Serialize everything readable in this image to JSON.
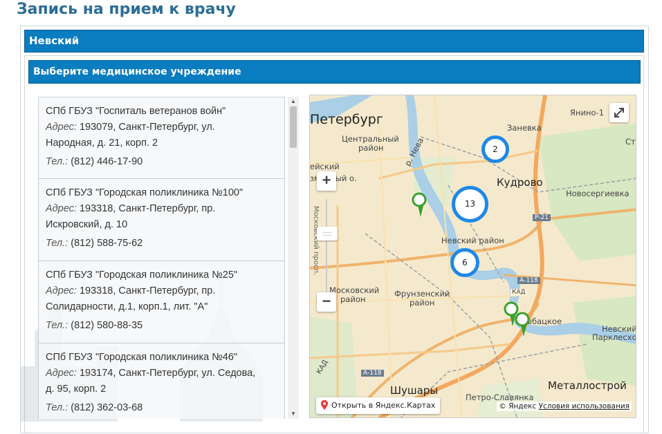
{
  "page": {
    "title": "Запись на прием к врачу"
  },
  "district": {
    "label": "Невский"
  },
  "chooser": {
    "label": "Выберите медицинское учреждение"
  },
  "institutions": [
    {
      "name": "СПб ГБУЗ \"Госпиталь ветеранов войн\"",
      "address_label": "Адрес:",
      "address_line1": "193079, Санкт-Петербург, ул.",
      "address_line2": "Народная, д. 21, корп. 2",
      "phone_label": "Тел.:",
      "phone": "(812) 446-17-90"
    },
    {
      "name": "СПб ГБУЗ \"Городская поликлиника №100\"",
      "address_label": "Адрес:",
      "address_line1": "193318, Санкт-Петербург, пр.",
      "address_line2": "Искровский, д. 10",
      "phone_label": "Тел.:",
      "phone": "(812) 588-75-62"
    },
    {
      "name": "СПб ГБУЗ \"Городская поликлиника №25\"",
      "address_label": "Адрес:",
      "address_line1": "193318, Санкт-Петербург, пр.",
      "address_line2": "Солидарности, д.1, корп.1, лит. \"А\"",
      "phone_label": "Тел.:",
      "phone": "(812) 580-88-35"
    },
    {
      "name": "СПб ГБУЗ \"Городская поликлиника №46\"",
      "address_label": "Адрес:",
      "address_line1": "193174, Санкт-Петербург, ул. Седова,",
      "address_line2": "д. 95, корп. 2",
      "phone_label": "Тел.:",
      "phone": "(812) 362-03-68"
    }
  ],
  "map": {
    "labels": {
      "city": "Петербург",
      "central": "Центральный",
      "central2": "район",
      "kudrovo": "Кудрово",
      "yanino": "Янино-1",
      "zanevka": "Заневка",
      "novosergievka": "Новосергиевка",
      "nevsky_district": "Невский район",
      "moskovsky": "Московский",
      "moskovsky2": "район",
      "frunzensky": "Фрунзенский",
      "frunzensky2": "район",
      "rybatskoe": "Рыбацкое",
      "nevsky_parklesk": "Невский",
      "nevsky_parklesk2": "Парклесхоз",
      "shushary": "Шушары",
      "metallostroy": "Металлострой",
      "petro": "Петро-Славянка",
      "neva": "р. Нева",
      "kad": "КАД",
      "a118": "А-118",
      "r21": "Р-21",
      "sviet": "Ст",
      "aisky": "ейский",
      "zmyanny": "змянный о.",
      "mosk_prosp": "Московский просп.",
      "kad2": "КАД"
    },
    "clusters": [
      {
        "count": "2"
      },
      {
        "count": "13"
      },
      {
        "count": "6"
      }
    ],
    "zoom_in": "+",
    "zoom_out": "−",
    "ruler_handle": ":::::",
    "open_in_maps": "Открыть в Яндекс.Картах",
    "copyright_prefix": "© Яндекс",
    "terms": "Условия использования",
    "cluster_color": "#1e88e5",
    "marker_color": "#3aa02c"
  }
}
